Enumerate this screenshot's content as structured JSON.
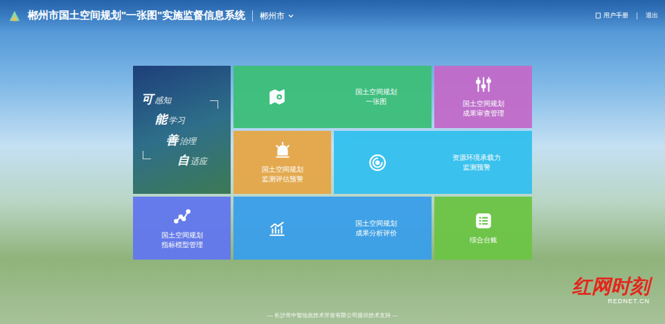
{
  "header": {
    "title": "郴州市国土空间规划\"一张图\"实施监督信息系统",
    "region": "郴州市",
    "user_manual": "用户手册",
    "logout": "退出"
  },
  "slogan": [
    {
      "big": "可",
      "small": "感知"
    },
    {
      "big": "能",
      "small": "学习"
    },
    {
      "big": "善",
      "small": "治理"
    },
    {
      "big": "自",
      "small": "适应"
    }
  ],
  "tiles": [
    {
      "kind": "map",
      "lines": [
        "国土空间规划",
        "一张图"
      ],
      "color": "#3dbf79"
    },
    {
      "kind": "review",
      "lines": [
        "国土空间规划",
        "成果审查管理"
      ],
      "color": "#c26bc9"
    },
    {
      "kind": "alarm",
      "lines": [
        "国土空间规划",
        "监测评估预警"
      ],
      "color": "#e6a747"
    },
    {
      "kind": "radar",
      "lines": [
        "资源环境承载力",
        "监测预警"
      ],
      "color": "#33c0ee"
    },
    {
      "kind": "model",
      "lines": [
        "国土空间规划",
        "指标模型管理"
      ],
      "color": "#6277ee"
    },
    {
      "kind": "chart",
      "lines": [
        "国土空间规划",
        "成果分析评价"
      ],
      "color": "#3a9fea"
    },
    {
      "kind": "ledger",
      "lines": [
        "综合台账"
      ],
      "color": "#6cc545"
    }
  ],
  "footer": "— 长沙市中智信息技术开发有限公司提供技术支持 —",
  "watermark": {
    "brand": "红网时刻",
    "site": "REDNET.CN"
  }
}
